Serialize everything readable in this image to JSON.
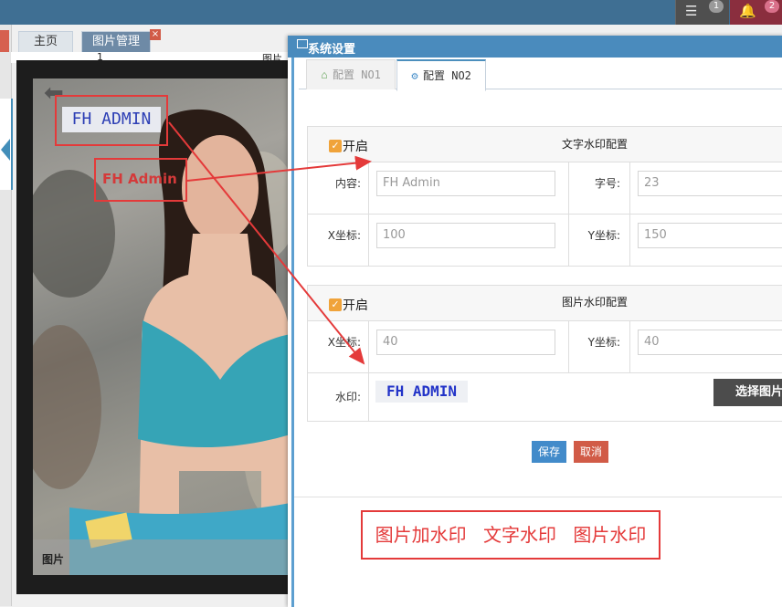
{
  "topbar": {
    "message_count": "1",
    "notification_count": "2"
  },
  "tabs": {
    "home": "主页",
    "pictures": "图片管理",
    "close": "×"
  },
  "grid": {
    "col_num": "1",
    "col_pic": "图片"
  },
  "viewer": {
    "caption": "图片",
    "text_watermark": "FH ADMIN",
    "image_watermark": "FH Admin"
  },
  "modal": {
    "title": "系统设置",
    "tab1": "配置 NO1",
    "tab2": "配置 NO2",
    "text_section": {
      "enable_label": "开启",
      "title": "文字水印配置",
      "content_label": "内容:",
      "content_placeholder": "FH Admin",
      "size_label": "字号:",
      "size_value": "23",
      "x_label": "X坐标:",
      "x_value": "100",
      "y_label": "Y坐标:",
      "y_value": "150"
    },
    "image_section": {
      "enable_label": "开启",
      "title": "图片水印配置",
      "x_label": "X坐标:",
      "x_value": "40",
      "y_label": "Y坐标:",
      "y_value": "40",
      "wm_label": "水印:",
      "wm_preview": "FH ADMIN",
      "choose_button": "选择图片"
    },
    "save": "保存",
    "cancel": "取消",
    "features": [
      "图片加水印",
      "文字水印",
      "图片水印"
    ]
  },
  "colors": {
    "accent": "#438eb9",
    "annotation": "#e43a3a",
    "checkbox": "#f0a33a"
  }
}
